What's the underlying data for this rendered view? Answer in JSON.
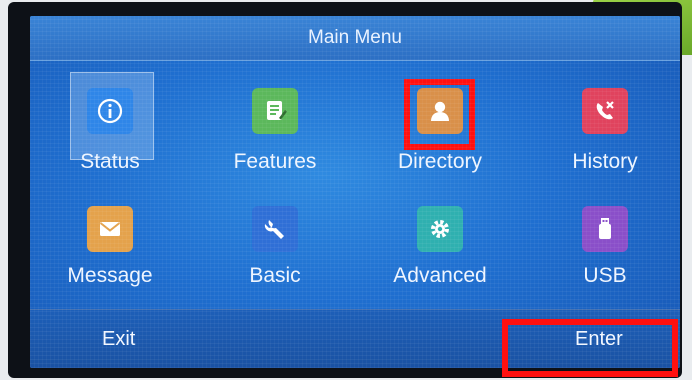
{
  "title": "Main Menu",
  "menu": [
    {
      "label": "Status",
      "icon": "info-icon",
      "color": "#2f86e8"
    },
    {
      "label": "Features",
      "icon": "notepad-icon",
      "color": "#5cb85c"
    },
    {
      "label": "Directory",
      "icon": "contact-card-icon",
      "color": "#d9904a"
    },
    {
      "label": "History",
      "icon": "call-history-icon",
      "color": "#e0435e"
    },
    {
      "label": "Message",
      "icon": "envelope-icon",
      "color": "#e4a24c"
    },
    {
      "label": "Basic",
      "icon": "wrench-icon",
      "color": "#2f6fd6"
    },
    {
      "label": "Advanced",
      "icon": "gear-icon",
      "color": "#2fb0b0"
    },
    {
      "label": "USB",
      "icon": "usb-drive-icon",
      "color": "#8a4fc9"
    }
  ],
  "softkeys": {
    "left": "Exit",
    "right": "Enter"
  },
  "highlight_color": "#ff1010"
}
